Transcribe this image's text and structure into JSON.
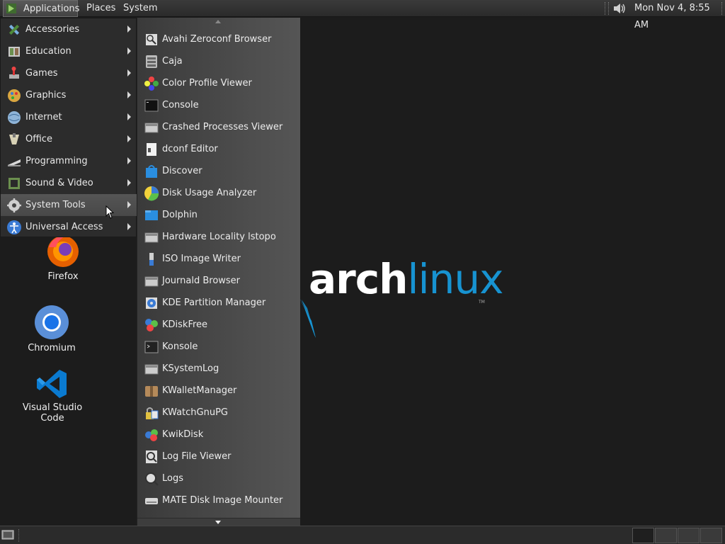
{
  "top_panel": {
    "applications_label": "Applications",
    "places_label": "Places",
    "system_label": "System",
    "clock": "Mon Nov 4,  8:55 AM"
  },
  "categories": [
    {
      "label": "Accessories",
      "icon": "accessories-icon"
    },
    {
      "label": "Education",
      "icon": "education-icon"
    },
    {
      "label": "Games",
      "icon": "games-icon"
    },
    {
      "label": "Graphics",
      "icon": "graphics-icon"
    },
    {
      "label": "Internet",
      "icon": "internet-icon"
    },
    {
      "label": "Office",
      "icon": "office-icon"
    },
    {
      "label": "Programming",
      "icon": "programming-icon"
    },
    {
      "label": "Sound & Video",
      "icon": "sound-video-icon"
    },
    {
      "label": "System Tools",
      "icon": "system-tools-icon",
      "active": true
    },
    {
      "label": "Universal Access",
      "icon": "universal-access-icon"
    }
  ],
  "system_tools": [
    {
      "label": "Avahi Zeroconf Browser",
      "icon": "avahi-icon"
    },
    {
      "label": "Caja",
      "icon": "caja-icon"
    },
    {
      "label": "Color Profile Viewer",
      "icon": "color-profile-icon"
    },
    {
      "label": "Console",
      "icon": "console-icon"
    },
    {
      "label": "Crashed Processes Viewer",
      "icon": "crashed-processes-icon"
    },
    {
      "label": "dconf Editor",
      "icon": "dconf-icon"
    },
    {
      "label": "Discover",
      "icon": "discover-icon"
    },
    {
      "label": "Disk Usage Analyzer",
      "icon": "disk-usage-icon"
    },
    {
      "label": "Dolphin",
      "icon": "dolphin-icon"
    },
    {
      "label": "Hardware Locality lstopo",
      "icon": "lstopo-icon"
    },
    {
      "label": "ISO Image Writer",
      "icon": "iso-writer-icon"
    },
    {
      "label": "Journald Browser",
      "icon": "journald-icon"
    },
    {
      "label": "KDE Partition Manager",
      "icon": "partition-manager-icon"
    },
    {
      "label": "KDiskFree",
      "icon": "kdiskfree-icon"
    },
    {
      "label": "Konsole",
      "icon": "konsole-icon"
    },
    {
      "label": "KSystemLog",
      "icon": "ksystemlog-icon"
    },
    {
      "label": "KWalletManager",
      "icon": "kwallet-icon"
    },
    {
      "label": "KWatchGnuPG",
      "icon": "kwatchgnupg-icon"
    },
    {
      "label": "KwikDisk",
      "icon": "kwikdisk-icon"
    },
    {
      "label": "Log File Viewer",
      "icon": "log-file-viewer-icon"
    },
    {
      "label": "Logs",
      "icon": "logs-icon"
    },
    {
      "label": "MATE Disk Image Mounter",
      "icon": "disk-image-mounter-icon"
    }
  ],
  "desktop_icons": {
    "firefox": "Firefox",
    "chromium": "Chromium",
    "vscode": "Visual Studio Code"
  },
  "wallpaper": {
    "word_a": "arch",
    "word_b": "linux",
    "tm": "TM"
  },
  "colors": {
    "arch_blue": "#1793d1",
    "panel": "#2b2b2b",
    "active_category": "#4e4e4e"
  }
}
